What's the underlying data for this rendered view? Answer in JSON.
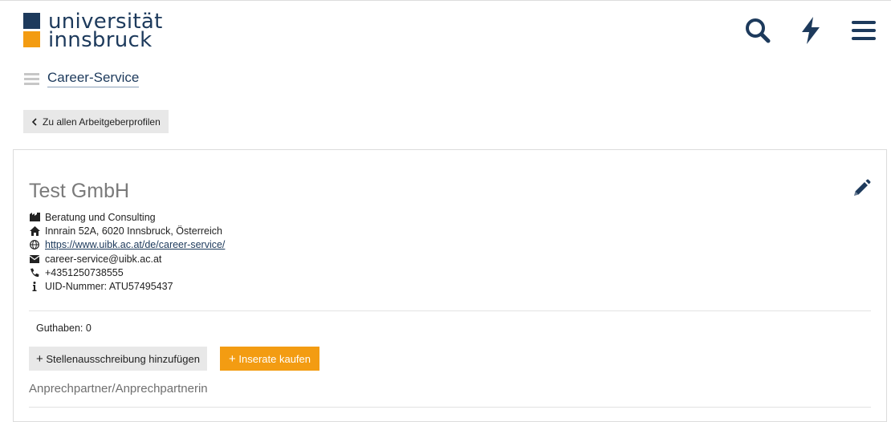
{
  "colors": {
    "brand_blue": "#1d3a5c",
    "brand_orange": "#f39c12",
    "button_grey": "#e8e8e8"
  },
  "header": {
    "logo_line1": "universität",
    "logo_line2": "innsbruck",
    "icons": [
      "search-icon",
      "lightning-icon",
      "hamburger-menu-icon"
    ]
  },
  "breadcrumb": {
    "label": "Career-Service"
  },
  "back_button": {
    "label": "Zu allen Arbeitgeberprofilen"
  },
  "company": {
    "name": "Test GmbH",
    "industry": "Beratung und Consulting",
    "address": "Innrain 52A, 6020 Innsbruck, Österreich",
    "website": "https://www.uibk.ac.at/de/career-service/",
    "email": "career-service@uibk.ac.at",
    "phone": "+4351250738555",
    "uid": "UID-Nummer: ATU57495437"
  },
  "balance": {
    "label": "Guthaben: 0"
  },
  "actions": {
    "add_job_label": "Stellenausschreibung hinzufügen",
    "buy_ads_label": "Inserate kaufen"
  },
  "contact": {
    "title": "Anprechpartner/Anprechpartnerin"
  }
}
